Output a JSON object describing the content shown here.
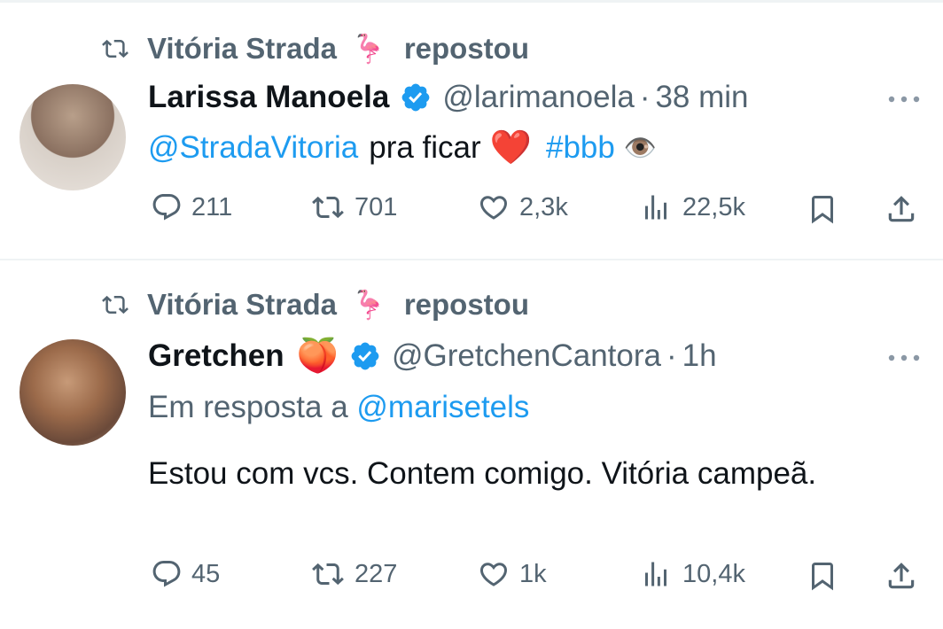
{
  "tweets": [
    {
      "repost_by": "Vitória Strada",
      "repost_emoji": "🦩",
      "repost_label": "repostou",
      "author_name": "Larissa Manoela",
      "author_handle": "@larimanoela",
      "separator": "·",
      "time": "38 min",
      "verified": true,
      "text_mention": "@StradaVitoria",
      "text_middle": "pra ficar",
      "text_heart": "❤️",
      "text_hashtag": "#bbb",
      "text_emoji": "👁️",
      "stats": {
        "replies": "211",
        "reposts": "701",
        "likes": "2,3k",
        "views": "22,5k"
      }
    },
    {
      "repost_by": "Vitória Strada",
      "repost_emoji": "🦩",
      "repost_label": "repostou",
      "author_name": "Gretchen",
      "author_emoji": "🍑",
      "author_handle": "@GretchenCantora",
      "separator": "·",
      "time": "1h",
      "verified": true,
      "reply_prefix": "Em resposta a",
      "reply_to": "@marisetels",
      "text": "Estou com vcs. Contem comigo. Vitória campeã.",
      "stats": {
        "replies": "45",
        "reposts": "227",
        "likes": "1k",
        "views": "10,4k"
      }
    }
  ],
  "colors": {
    "link": "#1d9bf0",
    "muted": "#536471",
    "text": "#0f1419",
    "verified": "#1d9bf0"
  },
  "icons": [
    "repost-icon",
    "verified-icon",
    "more-icon",
    "reply-icon",
    "like-icon",
    "views-icon",
    "bookmark-icon",
    "share-icon"
  ]
}
